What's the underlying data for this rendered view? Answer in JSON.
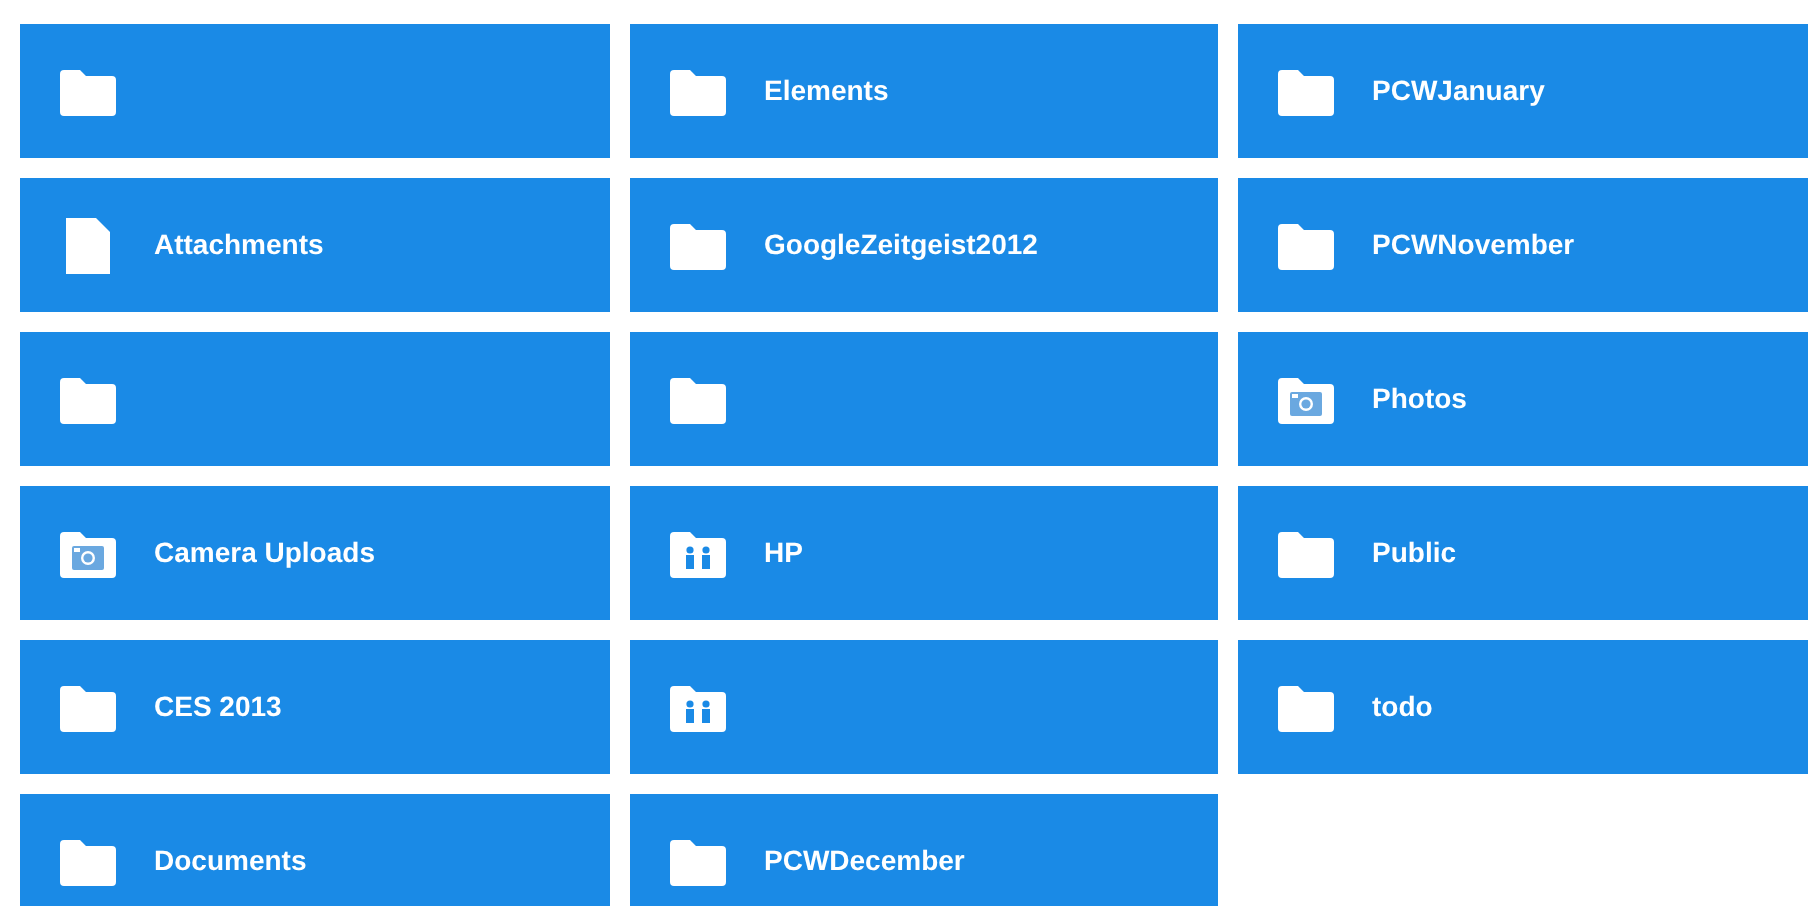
{
  "tiles": [
    {
      "kind": "folder"
    },
    {
      "kind": "folder",
      "label": "Elements"
    },
    {
      "kind": "folder",
      "label": "PCWJanuary"
    },
    {
      "kind": "file",
      "label": "Attachments"
    },
    {
      "kind": "folder",
      "label": "GoogleZeitgeist2012"
    },
    {
      "kind": "folder",
      "label": "PCWNovember"
    },
    {
      "kind": "folder"
    },
    {
      "kind": "folder"
    },
    {
      "kind": "camera",
      "label": "Photos"
    },
    {
      "kind": "camera",
      "label": "Camera Uploads"
    },
    {
      "kind": "shared",
      "label": "HP"
    },
    {
      "kind": "folder",
      "label": "Public"
    },
    {
      "kind": "folder",
      "label": "CES 2013"
    },
    {
      "kind": "shared"
    },
    {
      "kind": "folder",
      "label": "todo"
    },
    {
      "kind": "folder",
      "label": "Documents"
    },
    {
      "kind": "folder",
      "label": "PCWDecember"
    }
  ]
}
